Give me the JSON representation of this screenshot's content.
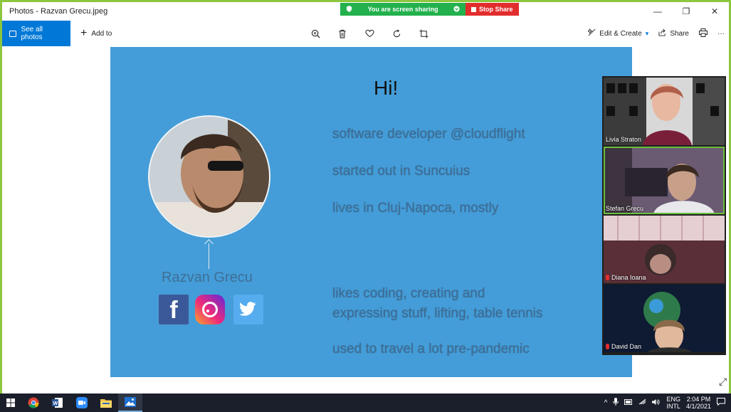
{
  "window": {
    "title": "Photos - Razvan Grecu.jpeg",
    "controls": {
      "minimize": "—",
      "restore": "❐",
      "close": "✕"
    }
  },
  "share_banner": {
    "status": "You are screen sharing",
    "stop_label": "Stop Share",
    "colors": {
      "banner": "#23b14d",
      "stop": "#e22d2d",
      "frame": "#8cc63f"
    }
  },
  "toolbar": {
    "see_all_label": "See all photos",
    "add_to_label": "Add to",
    "edit_create_label": "Edit & Create",
    "share_label": "Share",
    "more_label": "···",
    "icons": [
      "zoom-icon",
      "delete-icon",
      "favorite-icon",
      "rotate-icon",
      "crop-icon",
      "print-icon"
    ]
  },
  "slide": {
    "greeting": "Hi!",
    "lines": [
      "software developer @cloudflight",
      "started out in Suncuius",
      "lives in Cluj-Napoca, mostly",
      "likes coding, creating and",
      "expressing stuff, lifting, table tennis",
      "used to travel a lot pre-pandemic"
    ],
    "name": "Razvan Grecu",
    "social": {
      "facebook": "f"
    },
    "background": "#449dd8"
  },
  "participants": [
    {
      "name": "Livia Straton",
      "muted": false,
      "active": false
    },
    {
      "name": "Stefan Grecu",
      "muted": false,
      "active": true
    },
    {
      "name": "Diana Ioana",
      "muted": true,
      "active": false
    },
    {
      "name": "David Dan",
      "muted": true,
      "active": false
    }
  ],
  "taskbar": {
    "apps": [
      "windows-start-icon",
      "chrome-icon",
      "word-icon",
      "zoom-app-icon",
      "file-explorer-icon",
      "photos-app-icon"
    ],
    "tray": {
      "lang_top": "ENG",
      "lang_bottom": "INTL",
      "time": "2:04 PM",
      "date": "4/1/2021"
    }
  }
}
